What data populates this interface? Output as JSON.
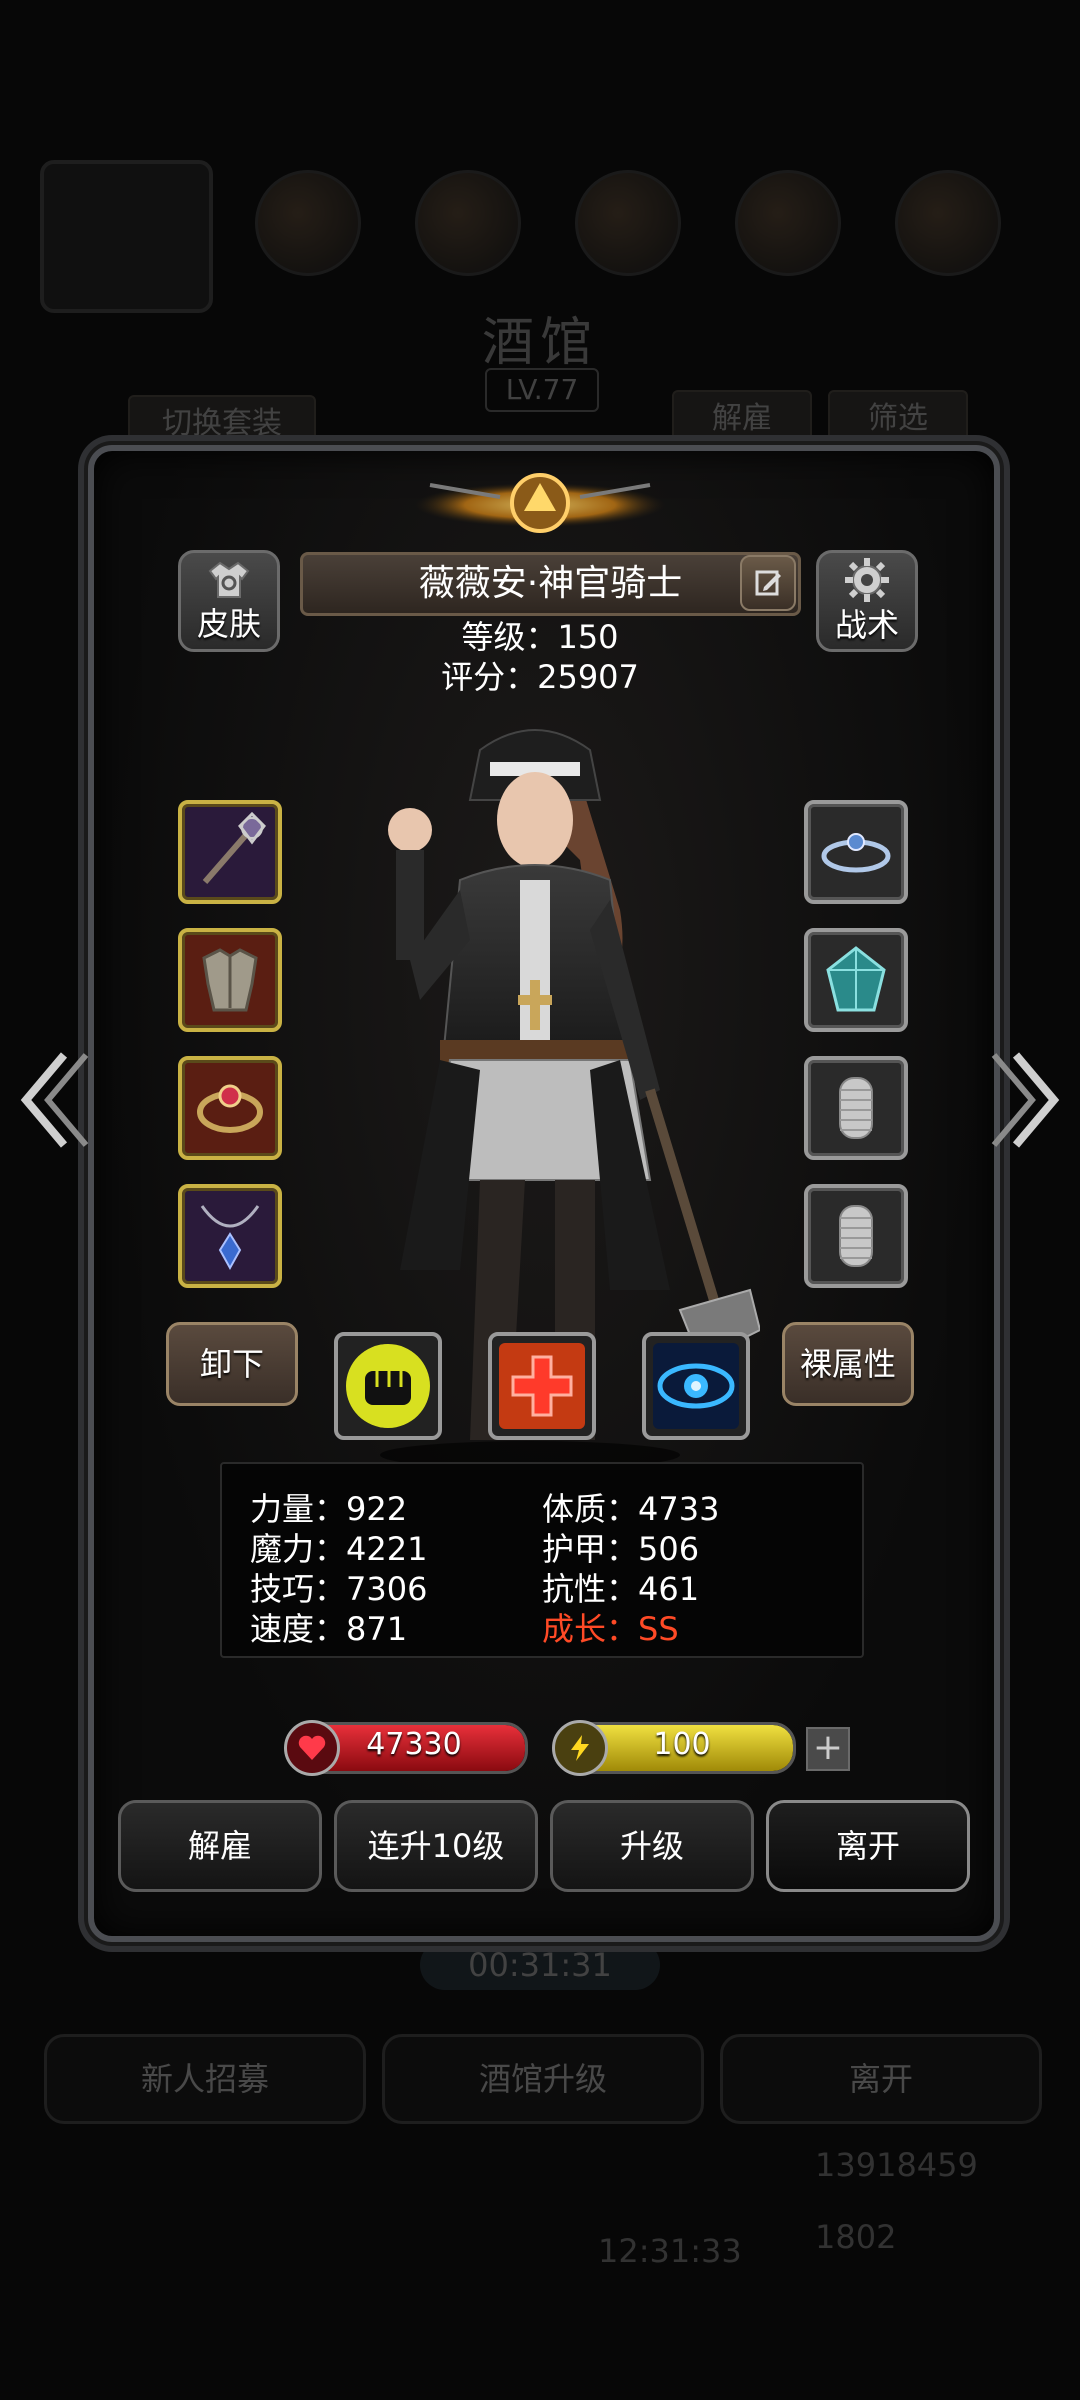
{
  "background": {
    "tavern_title": "酒馆",
    "tavern_level": "LV.77",
    "switch_outfit_label": "切换套装",
    "dismiss_label": "解雇",
    "filter_label": "筛选",
    "timer": "00:31:31",
    "bottom_buttons": [
      "新人招募",
      "酒馆升级",
      "离开"
    ],
    "clock": "12:31:33",
    "gold": "13918459",
    "gems": "1802"
  },
  "hero": {
    "name": "薇薇安·神官骑士",
    "level_line": "等级：150",
    "score_line": "评分：25907",
    "skin_label": "皮肤",
    "tactics_label": "战术"
  },
  "actions": {
    "unequip_label": "卸下",
    "base_attr_label": "裸属性"
  },
  "stats": {
    "strength": "力量：922",
    "magic": "魔力：4221",
    "skill": "技巧：7306",
    "speed": "速度：871",
    "constitution": "体质：4733",
    "armor": "护甲：506",
    "resistance": "抗性：461",
    "growth": "成长：SS"
  },
  "bars": {
    "hp": "47330",
    "energy": "100",
    "hp_fill": 1.0,
    "energy_fill": 1.0
  },
  "footer": {
    "dismiss": "解雇",
    "level_up_10": "连升10级",
    "level_up": "升级",
    "leave": "离开"
  },
  "colors": {
    "growth": "#ff4a26",
    "hp": "#c4141a",
    "energy": "#d6c418",
    "slot_gold": "#c9b244"
  }
}
